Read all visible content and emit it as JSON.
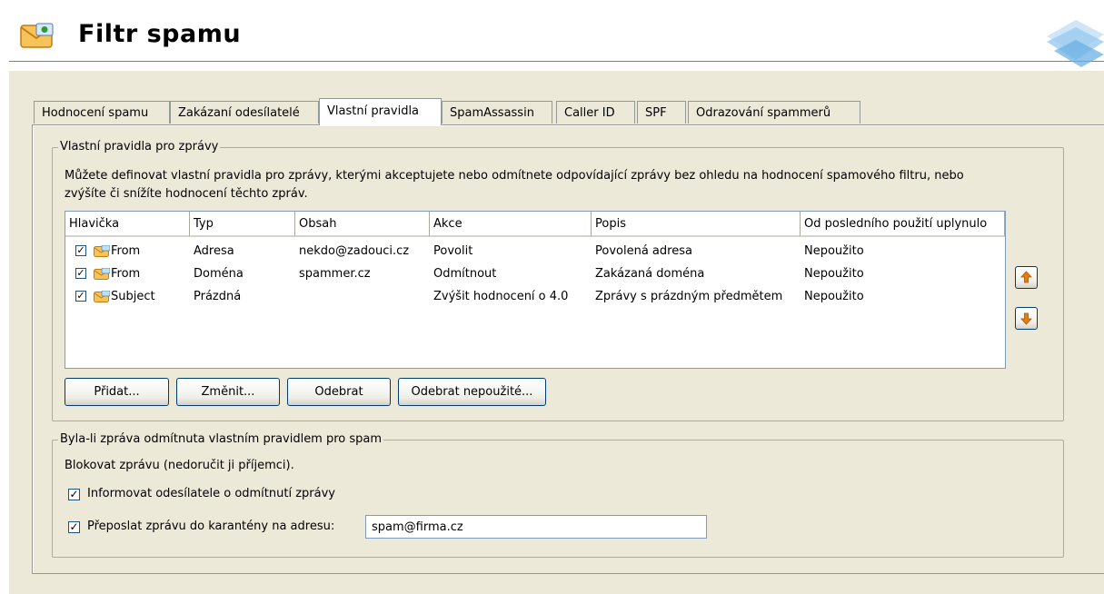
{
  "header": {
    "title": "Filtr spamu",
    "app_icon": "mail-filter-icon",
    "brand_icon": "kerio-logo-icon"
  },
  "tabs": [
    {
      "label": "Hodnocení spamu",
      "active": false
    },
    {
      "label": "Zakázaní odesílatelé",
      "active": false
    },
    {
      "label": "Vlastní pravidla",
      "active": true
    },
    {
      "label": "SpamAssassin",
      "active": false
    },
    {
      "label": "Caller ID",
      "active": false
    },
    {
      "label": "SPF",
      "active": false
    },
    {
      "label": "Odrazování spammerů",
      "active": false
    }
  ],
  "rules_group": {
    "title": "Vlastní pravidla pro zprávy",
    "description_line1": "Můžete definovat vlastní pravidla pro zprávy, kterými akceptujete nebo odmítnete odpovídající zprávy bez ohledu na hodnocení spamového filtru, nebo",
    "description_line2": "zvýšíte či snížíte hodnocení těchto zpráv."
  },
  "table": {
    "columns": [
      "Hlavička",
      "Typ",
      "Obsah",
      "Akce",
      "Popis",
      "Od posledního použití uplynulo"
    ],
    "rows": [
      {
        "checked": true,
        "header": "From",
        "type": "Adresa",
        "content": "nekdo@zadouci.cz",
        "action": "Povolit",
        "description": "Povolená adresa",
        "last_used": "Nepoužito"
      },
      {
        "checked": true,
        "header": "From",
        "type": "Doména",
        "content": "spammer.cz",
        "action": "Odmítnout",
        "description": "Zakázaná doména",
        "last_used": "Nepoužito"
      },
      {
        "checked": true,
        "header": "Subject",
        "type": "Prázdná",
        "content": "",
        "action": "Zvýšit hodnocení o 4.0",
        "description": "Zprávy s prázdným předmětem",
        "last_used": "Nepoužito"
      }
    ]
  },
  "buttons": {
    "add": "Přidat...",
    "edit": "Změnit...",
    "remove": "Odebrat",
    "remove_unused": "Odebrat nepoužité...",
    "move_up_icon": "arrow-up-icon",
    "move_down_icon": "arrow-down-icon"
  },
  "reject_group": {
    "title": "Byla-li zpráva odmítnuta vlastním pravidlem pro spam",
    "block_text": "Blokovat zprávu (nedoručit ji příjemci).",
    "notify_label": "Informovat odesílatele o odmítnutí zprávy",
    "notify_checked": true,
    "forward_label": "Přeposlat zprávu do karantény na adresu:",
    "forward_checked": true,
    "forward_address": "spam@firma.cz"
  },
  "colors": {
    "panel": "#ece9d8",
    "list_border": "#7f9db9",
    "arrow": "#e87d0d"
  }
}
